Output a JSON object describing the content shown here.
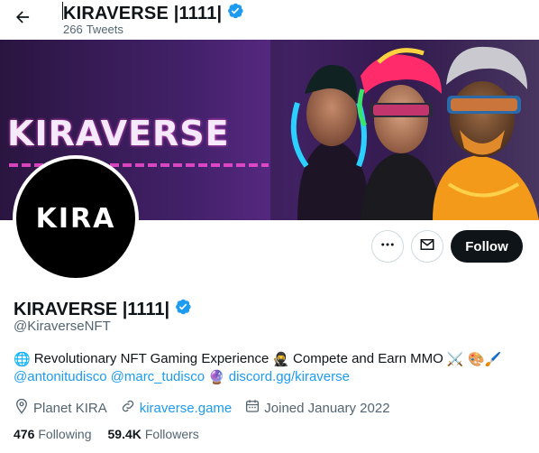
{
  "header": {
    "title": "KIRAVERSE |1111|",
    "tweet_count": "266",
    "tweet_label": "Tweets"
  },
  "banner": {
    "logo_text": "KIRAVERSE"
  },
  "avatar": {
    "text": "KIRA"
  },
  "actions": {
    "more_icon": "more-icon",
    "message_icon": "mail-icon",
    "follow_label": "Follow"
  },
  "profile": {
    "name": "KIRAVERSE |1111|",
    "handle": "@KiraverseNFT",
    "verified_color": "#1d9bf0"
  },
  "bio": {
    "line1_globe": "🌐",
    "line1_text": "Revolutionary NFT Gaming Experience",
    "line1_ninja": "🥷",
    "line1_text2": "Compete and Earn MMO",
    "line1_emojis": "⚔️ 🎨🖌️",
    "mention1": "@antonitudisco",
    "mention2": "@marc_tudisco",
    "crystal": "🔮",
    "discord_link": "discord.gg/kiraverse"
  },
  "meta": {
    "location": "Planet KIRA",
    "website": "kiraverse.game",
    "joined": "Joined January 2022"
  },
  "stats": {
    "following_count": "476",
    "following_label": "Following",
    "followers_count": "59.4K",
    "followers_label": "Followers"
  },
  "colors": {
    "accent": "#1d9bf0",
    "text": "#0f1419",
    "muted": "#536471"
  }
}
